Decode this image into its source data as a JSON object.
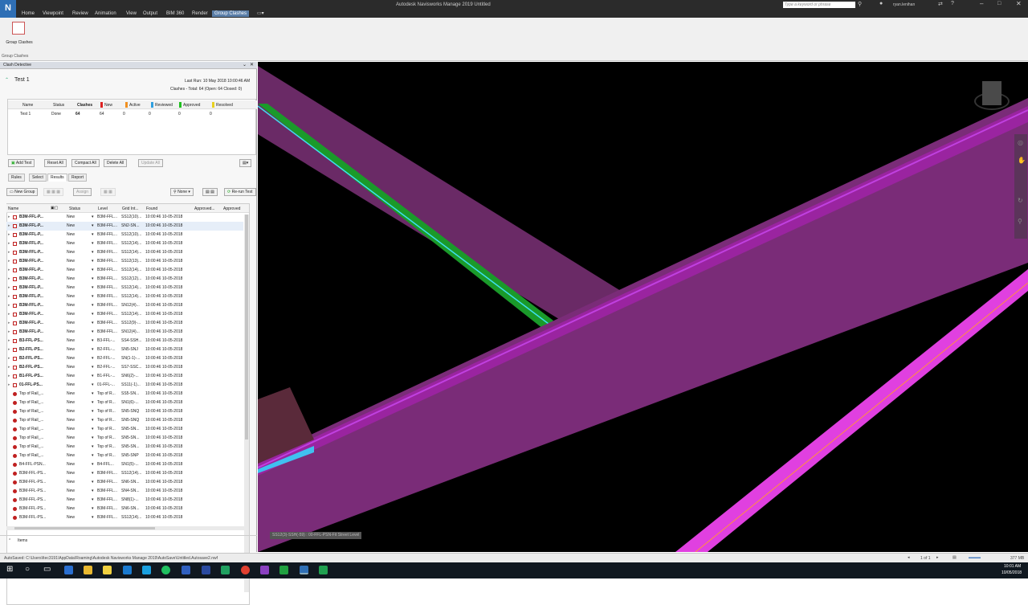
{
  "window": {
    "title": "Autodesk Navisworks Manage 2019   Untitled",
    "logo": "N",
    "search_placeholder": "Type a keyword or phrase",
    "user": "ryan.lenihan"
  },
  "menu": [
    "Home",
    "Viewpoint",
    "Review",
    "Animation",
    "View",
    "Output",
    "BIM 360",
    "Render",
    "Group Clashes"
  ],
  "menu_active": "Group Clashes",
  "ribbon": {
    "button_label": "Group Clashes",
    "panel_label": "Group Clashes"
  },
  "clash_detective": {
    "title": "Clash Detective",
    "test_name": "Test 1",
    "last_run": "Last Run:  10 May 2018 10:00:46 AM",
    "summary": "Clashes - Total:  64  (Open:  64  Closed:  0)",
    "tests_table": {
      "headers": [
        "Name",
        "Status",
        "Clashes",
        "New",
        "Active",
        "Reviewed",
        "Approved",
        "Resolved"
      ],
      "rows": [
        [
          "Test 1",
          "Done",
          "64",
          "64",
          "0",
          "0",
          "0",
          "0"
        ]
      ]
    },
    "buttons": {
      "add_test": "Add Test",
      "reset_all": "Reset All",
      "compact_all": "Compact All",
      "delete_all": "Delete All",
      "update_all": "Update All"
    },
    "tabs": [
      "Rules",
      "Select",
      "Results",
      "Report"
    ],
    "active_tab": "Results",
    "results_toolbar": {
      "new_group": "New Group",
      "assign": "Assign",
      "none": "None",
      "rerun": "Re-run Test"
    },
    "columns": [
      "Name",
      "Status",
      "Level",
      "Grid Int...",
      "Found",
      "Approved...",
      "Approved"
    ],
    "items_label": "Items",
    "results": [
      [
        "B3M-FFL-P...",
        "New",
        "B3M-FFL...",
        "SS12(10)...",
        "10:00:46 10-05-2018",
        "g"
      ],
      [
        "B3M-FFL-P...",
        "New",
        "B3M-FFL...",
        "SN2-SN...",
        "10:00:46 10-05-2018",
        "g"
      ],
      [
        "B3M-FFL-P...",
        "New",
        "B3M-FFL...",
        "SS12(10)...",
        "10:00:46 10-05-2018",
        "g"
      ],
      [
        "B3M-FFL-P...",
        "New",
        "B3M-FFL...",
        "SS12(14)...",
        "10:00:46 10-05-2018",
        "g"
      ],
      [
        "B3M-FFL-P...",
        "New",
        "B3M-FFL...",
        "SS12(14)...",
        "10:00:46 10-05-2018",
        "g"
      ],
      [
        "B3M-FFL-P...",
        "New",
        "B3M-FFL...",
        "SS12(13)...",
        "10:00:46 10-05-2018",
        "g"
      ],
      [
        "B3M-FFL-P...",
        "New",
        "B3M-FFL...",
        "SS12(14)...",
        "10:00:46 10-05-2018",
        "g"
      ],
      [
        "B3M-FFL-P...",
        "New",
        "B3M-FFL...",
        "SS12(12)...",
        "10:00:46 10-05-2018",
        "g"
      ],
      [
        "B3M-FFL-P...",
        "New",
        "B3M-FFL...",
        "SS12(14)...",
        "10:00:46 10-05-2018",
        "g"
      ],
      [
        "B3M-FFL-P...",
        "New",
        "B3M-FFL...",
        "SS12(14)...",
        "10:00:46 10-05-2018",
        "g"
      ],
      [
        "B3M-FFL-P...",
        "New",
        "B3M-FFL...",
        "SN12(4)...",
        "10:00:46 10-05-2018",
        "g"
      ],
      [
        "B3M-FFL-P...",
        "New",
        "B3M-FFL...",
        "SS12(14)...",
        "10:00:46 10-05-2018",
        "g"
      ],
      [
        "B3M-FFL-P...",
        "New",
        "B3M-FFL...",
        "SS12(9)-...",
        "10:00:46 10-05-2018",
        "g"
      ],
      [
        "B3M-FFL-P...",
        "New",
        "B3M-FFL...",
        "SN12(4)...",
        "10:00:46 10-05-2018",
        "g"
      ],
      [
        "B3-FFL-PS...",
        "New",
        "B3-FFL-...",
        "SS4-SSH...",
        "10:00:46 10-05-2018",
        "g"
      ],
      [
        "B2-FFL-PS...",
        "New",
        "B2-FFL-...",
        "SN5-SNJ",
        "10:00:46 10-05-2018",
        "g"
      ],
      [
        "B2-FFL-PS...",
        "New",
        "B2-FFL-...",
        "SN(1-1)-...",
        "10:00:46 10-05-2018",
        "g"
      ],
      [
        "B2-FFL-PS...",
        "New",
        "B2-FFL-...",
        "SS7-SSC...",
        "10:00:46 10-05-2018",
        "g"
      ],
      [
        "B1-FFL-PS...",
        "New",
        "B1-FFL-...",
        "SN6(2)-...",
        "10:00:46 10-05-2018",
        "g"
      ],
      [
        "01-FFL-PS...",
        "New",
        "01-FFL-...",
        "SS11(-1)...",
        "10:00:46 10-05-2018",
        "g"
      ],
      [
        "Top of Rail_...",
        "New",
        "Top of R...",
        "SS5-SN...",
        "10:00:46 10-05-2018",
        "c"
      ],
      [
        "Top of Rail_...",
        "New",
        "Top of R...",
        "SN1(6)-...",
        "10:00:46 10-05-2018",
        "c"
      ],
      [
        "Top of Rail_...",
        "New",
        "Top of R...",
        "SN5-SNQ",
        "10:00:46 10-05-2018",
        "c"
      ],
      [
        "Top of Rail_...",
        "New",
        "Top of R...",
        "SN5-SNQ",
        "10:00:46 10-05-2018",
        "c"
      ],
      [
        "Top of Rail_...",
        "New",
        "Top of R...",
        "SN5-SN...",
        "10:00:46 10-05-2018",
        "c"
      ],
      [
        "Top of Rail_...",
        "New",
        "Top of R...",
        "SN5-SN...",
        "10:00:46 10-05-2018",
        "c"
      ],
      [
        "Top of Rail_...",
        "New",
        "Top of R...",
        "SN5-SN...",
        "10:00:46 10-05-2018",
        "c"
      ],
      [
        "Top of Rail_...",
        "New",
        "Top of R...",
        "SN5-SNP",
        "10:00:46 10-05-2018",
        "c"
      ],
      [
        "B4-FFL-PSN...",
        "New",
        "B4-FFL...",
        "SN1(5)-...",
        "10:00:46 10-05-2018",
        "c"
      ],
      [
        "B3M-FFL-PS...",
        "New",
        "B3M-FFL...",
        "SS12(14)...",
        "10:00:46 10-05-2018",
        "c"
      ],
      [
        "B3M-FFL-PS...",
        "New",
        "B3M-FFL...",
        "SN6-SN...",
        "10:00:46 10-05-2018",
        "c"
      ],
      [
        "B3M-FFL-PS...",
        "New",
        "B3M-FFL...",
        "SN4-SN...",
        "10:00:46 10-05-2018",
        "c"
      ],
      [
        "B3M-FFL-PS...",
        "New",
        "B3M-FFL...",
        "SN8(1)-...",
        "10:00:46 10-05-2018",
        "c"
      ],
      [
        "B3M-FFL-PS...",
        "New",
        "B3M-FFL...",
        "SN6-SN...",
        "10:00:46 10-05-2018",
        "c"
      ],
      [
        "B3M-FFL-PS...",
        "New",
        "B3M-FFL...",
        "SS12(14)...",
        "10:00:46 10-05-2018",
        "c"
      ]
    ]
  },
  "viewport": {
    "tooltip": "SS12(3)-SSH(-59) : 00-FFL-PSN-Fit Street Level"
  },
  "status": {
    "path": "AutoSaved: C:\\Users\\ltec3191\\AppData\\Roaming\\Autodesk Navisworks Manage 2019\\AutoSave\\Untitled.Autosave2.nwf",
    "page": "1 of 1",
    "memory": "377 MB"
  },
  "clock": {
    "time": "10:01 AM",
    "date": "10/05/2018"
  }
}
